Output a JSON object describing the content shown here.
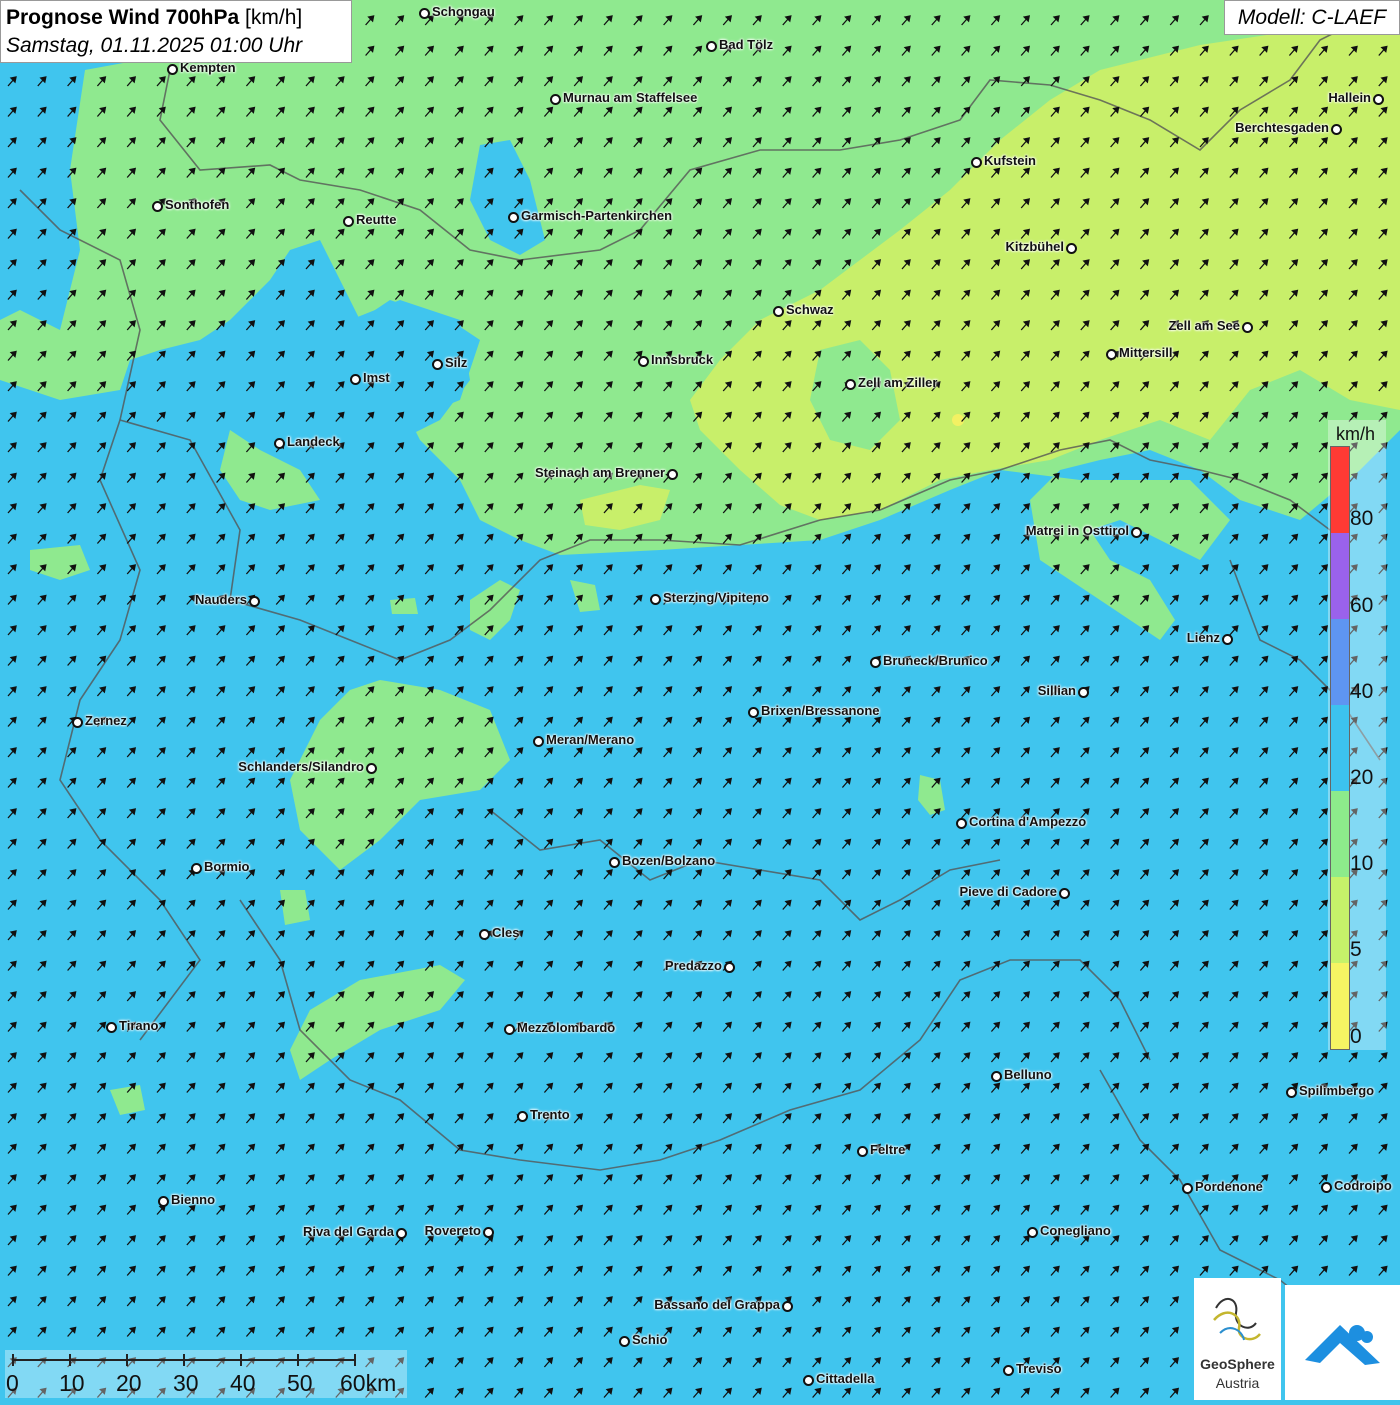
{
  "header": {
    "title_bold": "Prognose Wind 700hPa",
    "title_unit": "[km/h]",
    "datetime": "Samstag, 01.11.2025 01:00 Uhr",
    "model": "Modell: C-LAEF"
  },
  "legend": {
    "unit": "km/h",
    "labels": [
      "80",
      "60",
      "40",
      "20",
      "10",
      "5",
      "0"
    ],
    "colors": [
      "#ff3a34",
      "#9a62ec",
      "#5e95f2",
      "#3cc2ef",
      "#8deb8b",
      "#c6f26a",
      "#f6f463"
    ]
  },
  "colors": {
    "cyan_low": "#40c5ee",
    "green_10_20": "#8fe98f",
    "yellowgreen_5_10": "#c8ef6a",
    "yellow_0_5": "#f3f163",
    "border": "#555555",
    "arrow": "#111111"
  },
  "wind_direction_icon": "northeast-arrow-icon",
  "scalebar": {
    "labels": [
      "0",
      "10",
      "20",
      "30",
      "40",
      "50",
      "60km"
    ]
  },
  "logos": {
    "geosphere_line1": "GeoSphere",
    "geosphere_line2": "Austria"
  },
  "cities": [
    {
      "name": "Schongau"
    },
    {
      "name": "Bad Tölz"
    },
    {
      "name": "Kempten"
    },
    {
      "name": "Murnau am Staffelsee"
    },
    {
      "name": "Hallein"
    },
    {
      "name": "Berchtesgaden"
    },
    {
      "name": "Kufstein"
    },
    {
      "name": "Sonthofen"
    },
    {
      "name": "Reutte"
    },
    {
      "name": "Garmisch-Partenkirchen"
    },
    {
      "name": "Kitzbühel"
    },
    {
      "name": "Schwaz"
    },
    {
      "name": "Zell am See"
    },
    {
      "name": "Mittersill"
    },
    {
      "name": "Innsbruck"
    },
    {
      "name": "Imst"
    },
    {
      "name": "Silz"
    },
    {
      "name": "Zell am Ziller"
    },
    {
      "name": "Landeck"
    },
    {
      "name": "Steinach am Brenner"
    },
    {
      "name": "Matrei in Osttirol"
    },
    {
      "name": "Nauders"
    },
    {
      "name": "Sterzing/Vipiteno"
    },
    {
      "name": "Lienz"
    },
    {
      "name": "Bruneck/Brunico"
    },
    {
      "name": "Sillian"
    },
    {
      "name": "Brixen/Bressanone"
    },
    {
      "name": "Zernez"
    },
    {
      "name": "Meran/Merano"
    },
    {
      "name": "Schlanders/Silandro"
    },
    {
      "name": "Cortina d'Ampezzo"
    },
    {
      "name": "Bozen/Bolzano"
    },
    {
      "name": "Bormio"
    },
    {
      "name": "Pieve di Cadore"
    },
    {
      "name": "Cles"
    },
    {
      "name": "Predazzo"
    },
    {
      "name": "Tirano"
    },
    {
      "name": "Mezzolombardo"
    },
    {
      "name": "Belluno"
    },
    {
      "name": "Spilimbergo"
    },
    {
      "name": "Trento"
    },
    {
      "name": "Feltre"
    },
    {
      "name": "Bienno"
    },
    {
      "name": "Pordenone"
    },
    {
      "name": "Codroipo"
    },
    {
      "name": "Riva del Garda"
    },
    {
      "name": "Rovereto"
    },
    {
      "name": "Conegliano"
    },
    {
      "name": "Bassano del Grappa"
    },
    {
      "name": "Schio"
    },
    {
      "name": "Treviso"
    },
    {
      "name": "Cittadella"
    }
  ]
}
